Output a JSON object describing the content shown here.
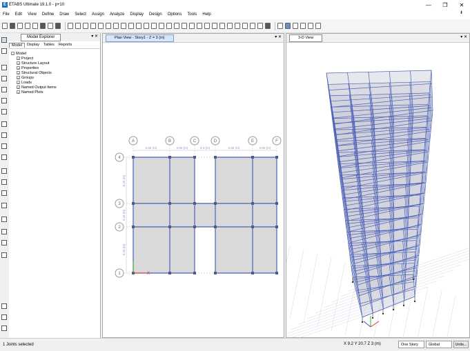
{
  "app": {
    "title": "ETABS Ultimate 19.1.0 - p+10",
    "icon_letter": "E"
  },
  "window_controls": {
    "minimize": "—",
    "restore": "❐",
    "close": "✕"
  },
  "menu": [
    "File",
    "Edit",
    "View",
    "Define",
    "Draw",
    "Select",
    "Assign",
    "Analyze",
    "Display",
    "Design",
    "Options",
    "Tools",
    "Help"
  ],
  "explorer": {
    "tab": "Model Explorer",
    "ctrls": "▾ ✕",
    "subtabs": [
      "Model",
      "Display",
      "Tables",
      "Reports"
    ],
    "root": "Model",
    "items": [
      "Project",
      "Structure Layout",
      "Properties",
      "Structural Objects",
      "Groups",
      "Loads",
      "Named Output Items",
      "Named Plots"
    ]
  },
  "plan": {
    "tab": "Plan View - Story1 - Z = 3 (m)",
    "ctrls": "▾ ✕",
    "grid_x": [
      "A",
      "B",
      "C",
      "D",
      "E",
      "F"
    ],
    "grid_y": [
      "4",
      "3",
      "2",
      "1"
    ],
    "x_dims": [
      "5.85 (m)",
      "3.85 (m)",
      "3.3 (m)",
      "5.85 (m)",
      "3.85 (m)"
    ],
    "y_dims": [
      "6.45 (m)",
      "3.45 (m)",
      "6.45 (m)"
    ],
    "axis_x": "X",
    "axis_y": "Y"
  },
  "view3d": {
    "tab": "3-D View",
    "ctrls": "▾ ✕"
  },
  "status": {
    "left": "1 Joints selected",
    "coords": "X 9.2  Y 20.7  Z 3 (m)",
    "story": "One Story",
    "coord_sys": "Global",
    "units": "Units..."
  },
  "colors": {
    "accent": "#1b6ec2",
    "frame": "#4a5fb5",
    "slab": "#d9d9d9",
    "node": "#4d5a8a"
  }
}
